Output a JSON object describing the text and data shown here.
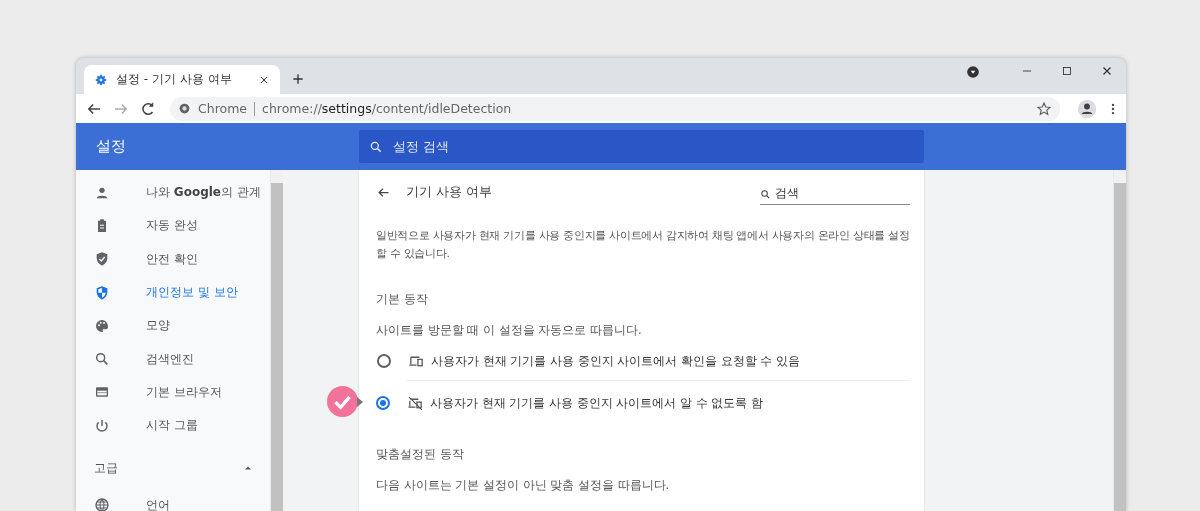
{
  "tab": {
    "title": "설정 - 기기 사용 여부",
    "selected": true
  },
  "address_bar": {
    "site_label": "Chrome",
    "url_scheme": "chrome://",
    "url_host": "settings",
    "url_path": "/content/idleDetection"
  },
  "header": {
    "title": "설정",
    "search_placeholder": "설정 검색"
  },
  "sidebar": {
    "items": [
      {
        "label": "나와 **Google**의 관계",
        "selected": false
      },
      {
        "label": "자동 완성",
        "selected": false
      },
      {
        "label": "안전 확인",
        "selected": false
      },
      {
        "label": "개인정보 및 보안",
        "selected": true
      },
      {
        "label": "모양",
        "selected": false
      },
      {
        "label": "검색엔진",
        "selected": false
      },
      {
        "label": "기본 브라우저",
        "selected": false
      },
      {
        "label": "시작 그룹",
        "selected": false
      }
    ],
    "section": {
      "label": "고급",
      "expanded": true
    },
    "advanced_items": [
      {
        "label": "언어",
        "selected": false
      }
    ]
  },
  "page": {
    "title": "기기 사용 여부",
    "search_placeholder": "검색",
    "description": "일반적으로 사용자가 현재 기기를 사용 중인지를 사이트에서 감지하여 채팅 앱에서 사용자의 온라인 상태를 설정할 수 있습니다.",
    "default_heading": "기본 동작",
    "default_subtitle": "사이트를 방문할 때 이 설정을 자동으로 따릅니다.",
    "options": [
      {
        "label": "사용자가 현재 기기를 사용 중인지 사이트에서 확인을 요청할 수 있음",
        "selected": false
      },
      {
        "label": "사용자가 현재 기기를 사용 중인지 사이트에서 알 수 없도록 함",
        "selected": true
      }
    ],
    "custom_heading": "맞춤설정된 동작",
    "custom_subtitle": "다음 사이트는 기본 설정이 아닌 맞춤 설정을 따릅니다."
  }
}
